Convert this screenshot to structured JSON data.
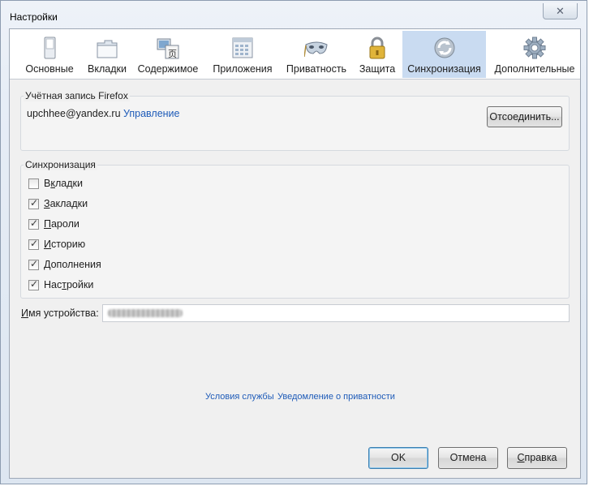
{
  "window": {
    "title": "Настройки",
    "close_glyph": "✕"
  },
  "tabs": [
    {
      "label": "Основные",
      "icon": "switch-icon",
      "selected": false
    },
    {
      "label": "Вкладки",
      "icon": "tabs-icon",
      "selected": false
    },
    {
      "label": "Содержимое",
      "icon": "content-icon",
      "selected": false
    },
    {
      "label": "Приложения",
      "icon": "applications-icon",
      "selected": false
    },
    {
      "label": "Приватность",
      "icon": "mask-icon",
      "selected": false
    },
    {
      "label": "Защита",
      "icon": "padlock-icon",
      "selected": false
    },
    {
      "label": "Синхронизация",
      "icon": "sync-icon",
      "selected": true
    },
    {
      "label": "Дополнительные",
      "icon": "gear-icon",
      "selected": false
    }
  ],
  "account": {
    "group_title": "Учётная запись Firefox",
    "email": "upchhee@yandex.ru",
    "manage_link": "Управление",
    "disconnect_button": "Отсоединить..."
  },
  "sync": {
    "group_title": "Синхронизация",
    "items": [
      {
        "pre": "В",
        "acc": "к",
        "post": "ладки",
        "checked": false
      },
      {
        "pre": "",
        "acc": "З",
        "post": "акладки",
        "checked": true
      },
      {
        "pre": "",
        "acc": "П",
        "post": "ароли",
        "checked": true
      },
      {
        "pre": "",
        "acc": "И",
        "post": "сторию",
        "checked": true
      },
      {
        "pre": "",
        "acc": "Д",
        "post": "ополнения",
        "checked": true
      },
      {
        "pre": "Нас",
        "acc": "т",
        "post": "ройки",
        "checked": true
      }
    ]
  },
  "device": {
    "label_pre": "",
    "label_acc": "И",
    "label_post": "мя устройства:",
    "value_hidden": "blurred"
  },
  "footer_links": {
    "terms": "Условия службы",
    "privacy": "Уведомление о приватности"
  },
  "buttons": {
    "ok": "OK",
    "cancel": "Отмена",
    "help_acc": "С",
    "help_post": "правка"
  },
  "colors": {
    "selected_tab": "#c9dbf1",
    "link": "#1e5bb8"
  }
}
